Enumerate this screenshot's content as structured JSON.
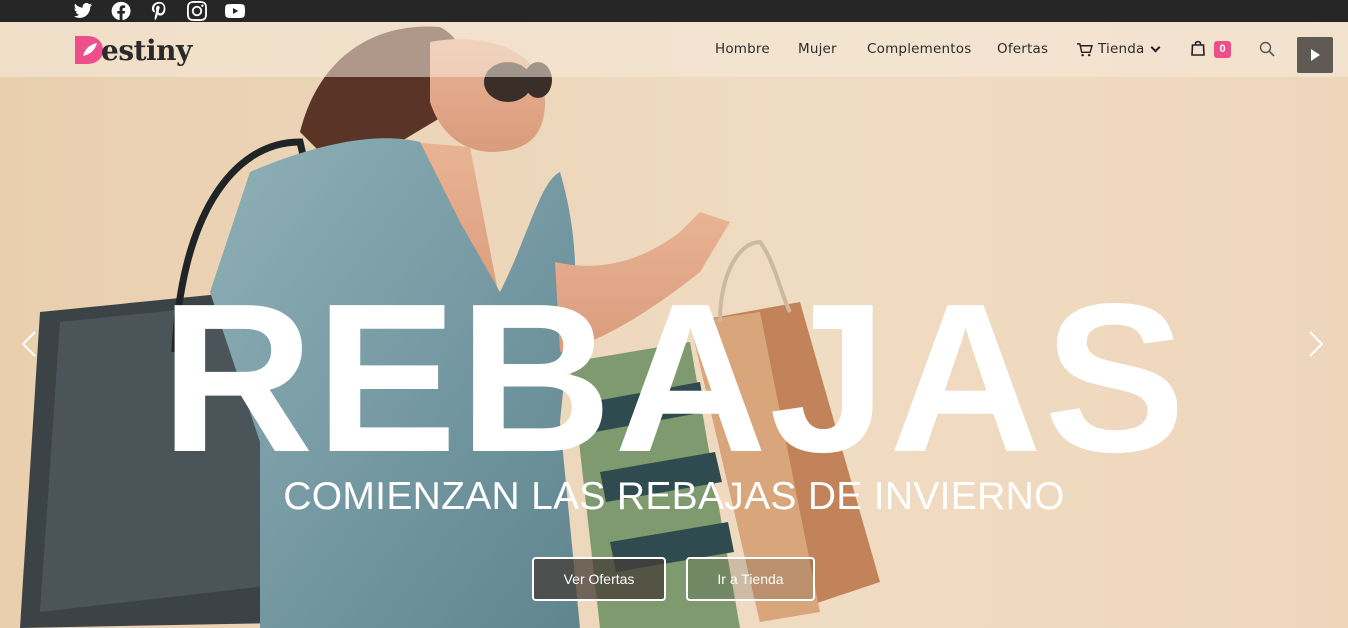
{
  "social": [
    {
      "icon": "twitter-icon"
    },
    {
      "icon": "facebook-icon"
    },
    {
      "icon": "pinterest-icon"
    },
    {
      "icon": "instagram-icon"
    },
    {
      "icon": "youtube-icon"
    }
  ],
  "brand": {
    "name": "estiny",
    "initial": "D",
    "accent": "#ee4e8b"
  },
  "nav": {
    "items": [
      "Hombre",
      "Mujer",
      "Complementos",
      "Ofertas"
    ],
    "store_label": "Tienda",
    "cart_count": "0"
  },
  "hero": {
    "headline": "REBAJAS",
    "subheadline": "COMIENZAN LAS REBAJAS DE INVIERNO",
    "primary_button": "Ver Ofertas",
    "secondary_button": "Ir a Tienda"
  },
  "colors": {
    "topbar": "#262626",
    "badge": "#ee4e8b",
    "text": "#2c2c2c"
  }
}
